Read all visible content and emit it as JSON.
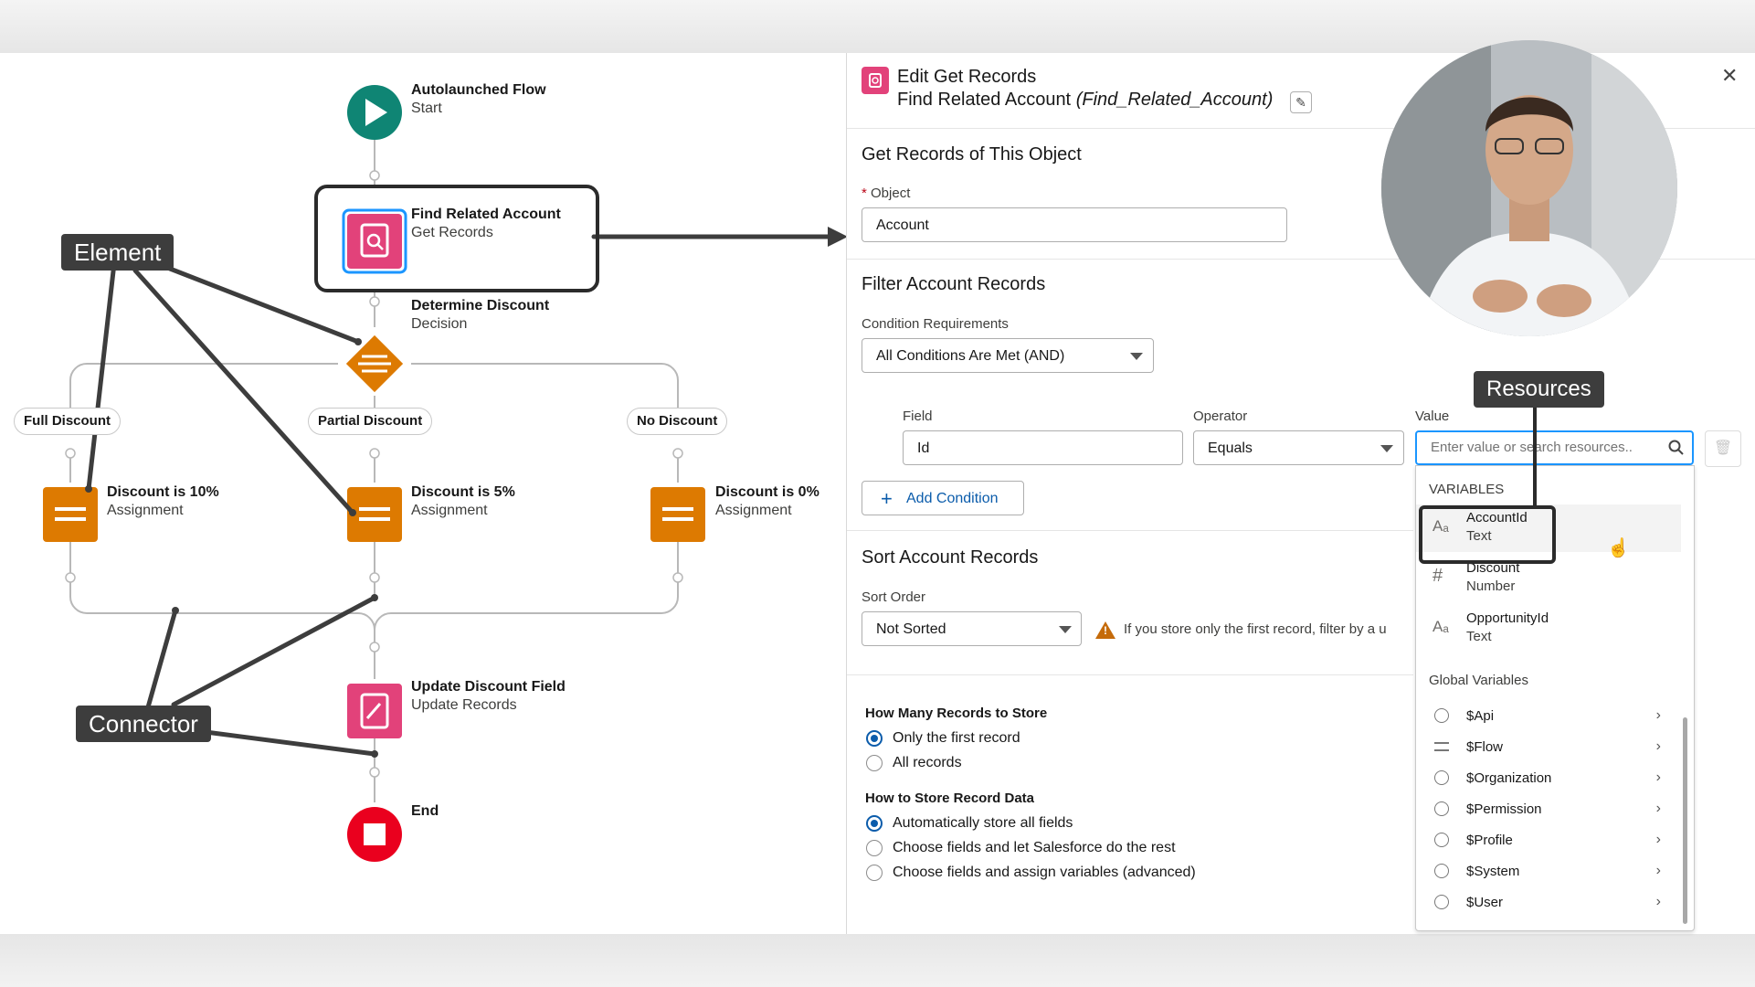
{
  "flow": {
    "start": {
      "title": "Autolaunched Flow",
      "sub": "Start"
    },
    "get_records": {
      "title": "Find Related Account",
      "sub": "Get Records"
    },
    "decision": {
      "title": "Determine Discount",
      "sub": "Decision"
    },
    "outcomes": [
      "Full Discount",
      "Partial Discount",
      "No Discount"
    ],
    "assignments": [
      {
        "title": "Discount is 10%",
        "sub": "Assignment"
      },
      {
        "title": "Discount is 5%",
        "sub": "Assignment"
      },
      {
        "title": "Discount is 0%",
        "sub": "Assignment"
      }
    ],
    "update": {
      "title": "Update Discount Field",
      "sub": "Update Records"
    },
    "end": {
      "title": "End"
    }
  },
  "callouts": {
    "element": "Element",
    "connector": "Connector",
    "resources": "Resources"
  },
  "panel": {
    "title": "Edit Get Records",
    "subtitle": "Find Related Account",
    "api_name": "(Find_Related_Account)",
    "section_object": "Get Records of This Object",
    "object_label": "Object",
    "object_required": "*",
    "object_value": "Account",
    "section_filter": "Filter Account Records",
    "cond_req_label": "Condition Requirements",
    "cond_req_value": "All Conditions Are Met (AND)",
    "field_label": "Field",
    "field_value": "Id",
    "operator_label": "Operator",
    "operator_value": "Equals",
    "value_label": "Value",
    "value_placeholder": "Enter value or search resources...",
    "value_visible": "Enter value or search resources..",
    "add_condition": "Add Condition",
    "section_sort": "Sort Account Records",
    "sort_order_label": "Sort Order",
    "sort_order_value": "Not Sorted",
    "warning_text": "If you store only the first record, filter by a u",
    "how_many_label": "How Many Records to Store",
    "how_many_options": [
      "Only the first record",
      "All records"
    ],
    "how_store_label": "How to Store Record Data",
    "how_store_options": [
      "Automatically store all fields",
      "Choose fields and let Salesforce do the rest",
      "Choose fields and assign variables (advanced)"
    ]
  },
  "dropdown": {
    "variables_header": "VARIABLES",
    "variables": [
      {
        "name": "AccountId",
        "type": "Text",
        "icon": "text-type-icon"
      },
      {
        "name": "Discount",
        "type": "Number",
        "icon": "number-type-icon"
      },
      {
        "name": "OpportunityId",
        "type": "Text",
        "icon": "text-type-icon"
      }
    ],
    "global_header": "Global Variables",
    "globals": [
      "$Api",
      "$Flow",
      "$Organization",
      "$Permission",
      "$Profile",
      "$System",
      "$User"
    ]
  },
  "colors": {
    "start": "#0f8574",
    "get_records": "#e2427a",
    "decision": "#dd7a01",
    "end": "#ea001e",
    "brand": "#0b5cab"
  }
}
